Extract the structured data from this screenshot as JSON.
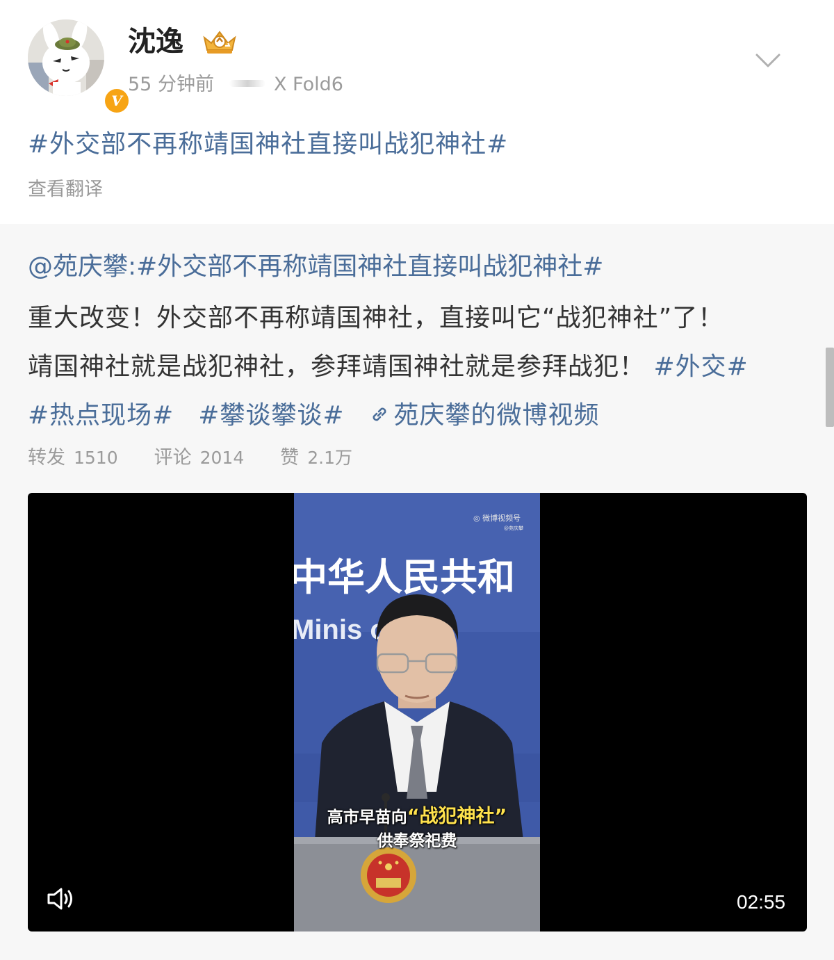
{
  "post": {
    "username": "沈逸",
    "time": "55 分钟前",
    "device": "X Fold6",
    "topic": "#外交部不再称靖国神社直接叫战犯神社#",
    "translate": "查看翻译"
  },
  "repost": {
    "author": "@苑庆攀:",
    "author_topic": "#外交部不再称靖国神社直接叫战犯神社#",
    "line1": "重大改变！外交部不再称靖国神社，直接叫它“战犯神社”了！",
    "line2": "靖国神社就是战犯神社，参拜靖国神社就是参拜战犯！",
    "tag_waijiao": "#外交#",
    "tag_redian": "#热点现场#",
    "tag_pantan": "#攀谈攀谈#",
    "video_link": "苑庆攀的微博视频",
    "stats": {
      "repost_label": "转发",
      "repost_count": "1510",
      "comment_label": "评论",
      "comment_count": "2014",
      "like_label": "赞",
      "like_count": "2.1万"
    }
  },
  "video": {
    "subtitle_prefix": "高市早苗向",
    "subtitle_highlight": "“战犯神社”",
    "subtitle_line2": "供奉祭祀费",
    "backdrop_cn": "中华人民共和",
    "backdrop_en": "Minis  of Fo",
    "watermark": "微博视频号",
    "watermark_sub": "@苑庆攀",
    "duration": "02:55"
  },
  "icons": {
    "verified": "verified-v-icon",
    "crown": "crown-badge-icon",
    "expand": "chevron-down-icon",
    "link": "link-icon",
    "sound": "speaker-icon"
  },
  "colors": {
    "link_blue": "#4a6d99",
    "muted_gray": "#9b9b9b",
    "verified_orange": "#f7a414",
    "subtitle_yellow": "#ffe24d",
    "backdrop_blue": "#3f5aa8"
  }
}
